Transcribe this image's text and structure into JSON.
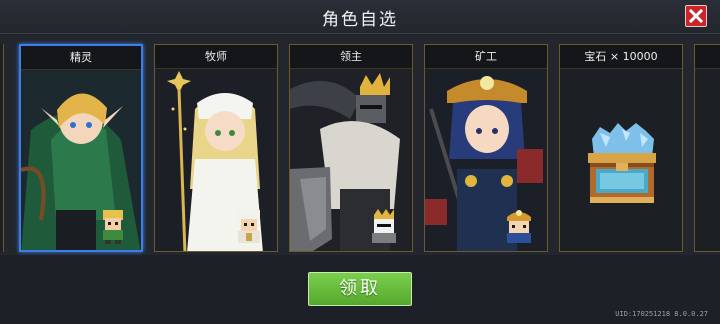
{
  "window": {
    "title": "角色自选"
  },
  "cards": [
    {
      "label": "精灵",
      "selected": true
    },
    {
      "label": "牧师",
      "selected": false
    },
    {
      "label": "领主",
      "selected": false
    },
    {
      "label": "矿工",
      "selected": false
    },
    {
      "label": "宝石 × 10000",
      "selected": false
    }
  ],
  "actions": {
    "claim_label": "领取"
  },
  "footer": {
    "uid": "UID:170251218 8.0.0.27"
  },
  "colors": {
    "accent_border": "#3d7ee8",
    "card_border": "#6b5a2c",
    "claim_green": "#66bc3a",
    "close_red": "#c8262a"
  },
  "icons": {
    "close": "close-icon",
    "gems": "gem-chest-icon"
  }
}
